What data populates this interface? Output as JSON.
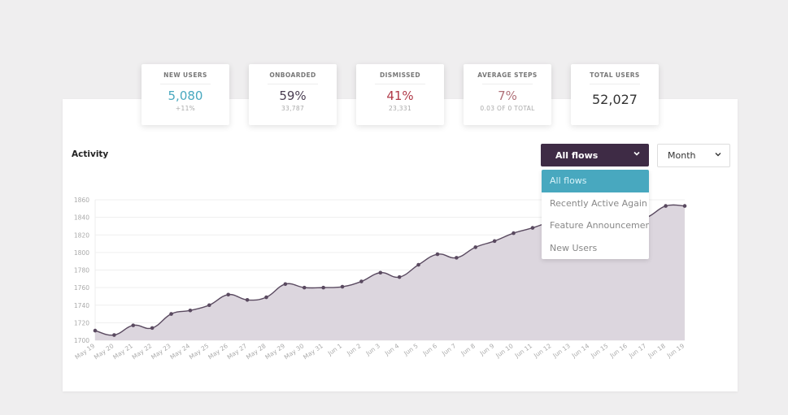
{
  "stats": [
    {
      "label": "NEW USERS",
      "value": "5,080",
      "sub": "+11%",
      "color": "#48a8bf"
    },
    {
      "label": "ONBOARDED",
      "value": "59%",
      "sub": "33,787",
      "color": "#4a3d52"
    },
    {
      "label": "DISMISSED",
      "value": "41%",
      "sub": "23,331",
      "color": "#b03a48"
    },
    {
      "label": "AVERAGE STEPS",
      "value": "7%",
      "sub": "0.03 OF 0 TOTAL",
      "color": "#b07078"
    },
    {
      "label": "TOTAL USERS",
      "value": "52,027",
      "sub": "",
      "color": "#333333"
    }
  ],
  "activity": {
    "title": "Activity",
    "flow_select": {
      "selected": "All flows",
      "options": [
        "All flows",
        "Recently Active Again",
        "Feature Announcement",
        "New Users"
      ]
    },
    "period_select": {
      "selected": "Month"
    }
  },
  "colors": {
    "accent_dark": "#3e2b45",
    "accent_teal": "#48a8bf",
    "area_fill": "#dcd6de",
    "line": "#5a4a60"
  },
  "chart_data": {
    "type": "area",
    "title": "Activity",
    "xlabel": "",
    "ylabel": "",
    "ylim": [
      1700,
      1860
    ],
    "yticks": [
      1700,
      1720,
      1740,
      1760,
      1780,
      1800,
      1820,
      1840,
      1860
    ],
    "grid": true,
    "categories": [
      "May 19",
      "May 20",
      "May 21",
      "May 22",
      "May 23",
      "May 24",
      "May 25",
      "May 26",
      "May 27",
      "May 28",
      "May 29",
      "May 30",
      "May 31",
      "Jun 1",
      "Jun 2",
      "Jun 3",
      "Jun 4",
      "Jun 5",
      "Jun 6",
      "Jun 7",
      "Jun 8",
      "Jun 9",
      "Jun 10",
      "Jun 11",
      "Jun 12",
      "Jun 13",
      "Jun 14",
      "Jun 15",
      "Jun 16",
      "Jun 17",
      "Jun 18",
      "Jun 19"
    ],
    "series": [
      {
        "name": "All flows",
        "values": [
          1711,
          1706,
          1717,
          1714,
          1730,
          1734,
          1740,
          1752,
          1746,
          1749,
          1764,
          1760,
          1760,
          1761,
          1767,
          1777,
          1772,
          1786,
          1798,
          1794,
          1806,
          1813,
          1822,
          1828,
          1835,
          1837,
          1838,
          1836,
          1838,
          1840,
          1853,
          1853
        ]
      }
    ]
  }
}
